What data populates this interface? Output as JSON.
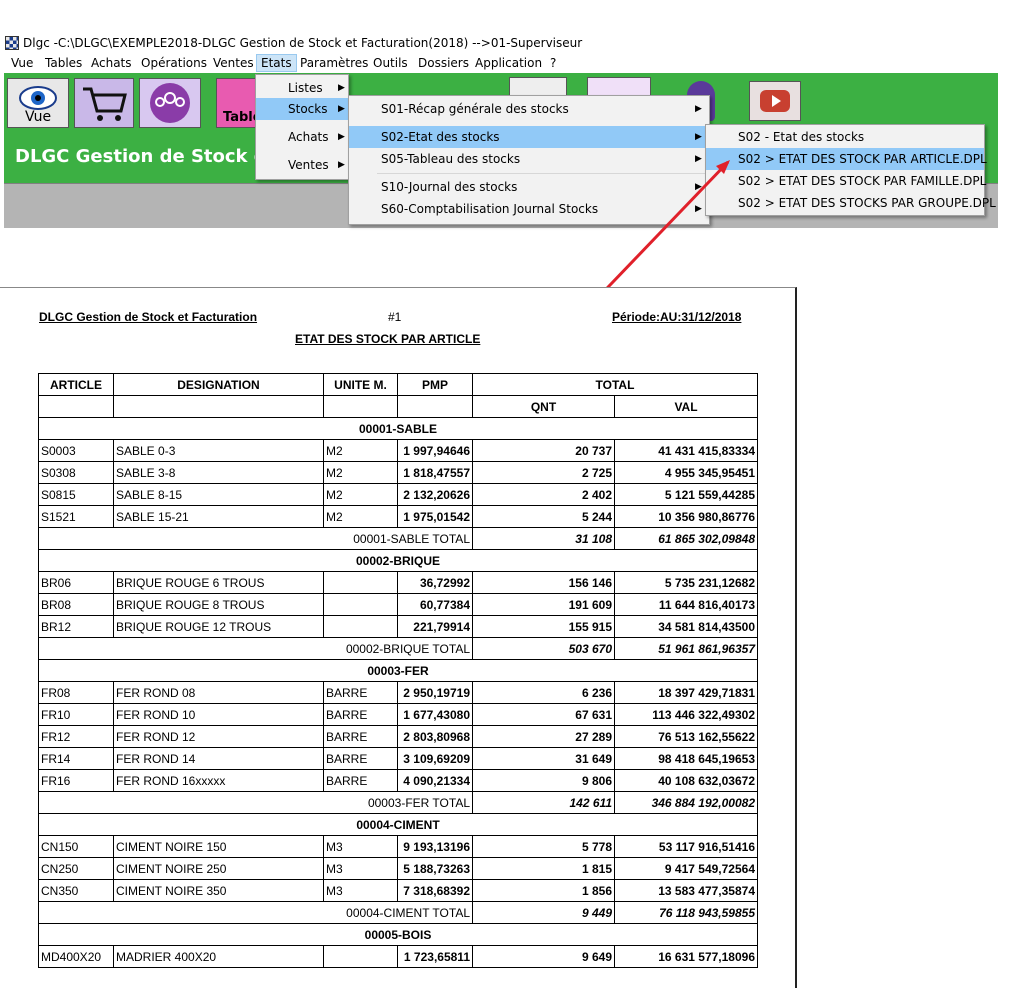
{
  "window": {
    "title": "Dlgc -C:\\DLGC\\EXEMPLE2018-DLGC Gestion de Stock et Facturation(2018) -->01-Superviseur"
  },
  "menubar": [
    "Vue",
    "Tables",
    "Achats",
    "Opérations",
    "Ventes",
    "Etats",
    "Paramètres",
    "Outils",
    "Dossiers",
    "Application",
    "?"
  ],
  "toolbar": {
    "vue_label": "Vue",
    "tables_label": "Table"
  },
  "app_title": "DLGC Gestion de Stock e",
  "menu_etats": [
    "Listes",
    "Stocks",
    "Achats",
    "Ventes"
  ],
  "menu_stocks": [
    "S01-Récap générale des stocks",
    "S02-Etat des stocks",
    "S05-Tableau des stocks",
    "S10-Journal des stocks",
    "S60-Comptabilisation Journal Stocks"
  ],
  "menu_s02": [
    "S02 - Etat des stocks",
    "S02 > ETAT DES STOCK PAR ARTICLE.DPL",
    "S02 > ETAT DES STOCK PAR FAMILLE.DPL",
    "S02 > ETAT DES STOCKS PAR GROUPE.DPL"
  ],
  "colors": {
    "toolbar_green": "#3cb043",
    "highlight": "#91c9f7",
    "arrow_red": "#e0202a"
  },
  "report": {
    "company": "DLGC Gestion de Stock et Facturation",
    "page": "#1",
    "period": "Période:AU:31/12/2018",
    "title": "ETAT DES STOCK PAR ARTICLE",
    "headers": {
      "article": "ARTICLE",
      "designation": "DESIGNATION",
      "unite": "UNITE M.",
      "pmp": "PMP",
      "total": "TOTAL",
      "qnt": "QNT",
      "val": "VAL"
    },
    "groups": [
      {
        "name": "00001-SABLE",
        "rows": [
          [
            "S0003",
            "SABLE 0-3",
            "M2",
            "1 997,94646",
            "20 737",
            "41 431 415,83334"
          ],
          [
            "S0308",
            "SABLE 3-8",
            "M2",
            "1 818,47557",
            "2 725",
            "4 955 345,95451"
          ],
          [
            "S0815",
            "SABLE 8-15",
            "M2",
            "2 132,20626",
            "2 402",
            "5 121 559,44285"
          ],
          [
            "S1521",
            "SABLE 15-21",
            "M2",
            "1 975,01542",
            "5 244",
            "10 356 980,86776"
          ]
        ],
        "total_label": "00001-SABLE  TOTAL",
        "total_qnt": "31 108",
        "total_val": "61 865 302,09848"
      },
      {
        "name": "00002-BRIQUE",
        "rows": [
          [
            "BR06",
            "BRIQUE ROUGE 6 TROUS",
            "",
            "36,72992",
            "156 146",
            "5 735 231,12682"
          ],
          [
            "BR08",
            "BRIQUE ROUGE 8 TROUS",
            "",
            "60,77384",
            "191 609",
            "11 644 816,40173"
          ],
          [
            "BR12",
            "BRIQUE ROUGE 12 TROUS",
            "",
            "221,79914",
            "155 915",
            "34 581 814,43500"
          ]
        ],
        "total_label": "00002-BRIQUE  TOTAL",
        "total_qnt": "503 670",
        "total_val": "51 961 861,96357"
      },
      {
        "name": "00003-FER",
        "rows": [
          [
            "FR08",
            "FER ROND 08",
            "BARRE",
            "2 950,19719",
            "6 236",
            "18 397 429,71831"
          ],
          [
            "FR10",
            "FER ROND 10",
            "BARRE",
            "1 677,43080",
            "67 631",
            "113 446 322,49302"
          ],
          [
            "FR12",
            "FER ROND 12",
            "BARRE",
            "2 803,80968",
            "27 289",
            "76 513 162,55622"
          ],
          [
            "FR14",
            "FER ROND 14",
            "BARRE",
            "3 109,69209",
            "31 649",
            "98 418 645,19653"
          ],
          [
            "FR16",
            "FER ROND 16xxxxx",
            "BARRE",
            "4 090,21334",
            "9 806",
            "40 108 632,03672"
          ]
        ],
        "total_label": "00003-FER  TOTAL",
        "total_qnt": "142 611",
        "total_val": "346 884 192,00082"
      },
      {
        "name": "00004-CIMENT",
        "rows": [
          [
            "CN150",
            "CIMENT NOIRE 150",
            "M3",
            "9 193,13196",
            "5 778",
            "53 117 916,51416"
          ],
          [
            "CN250",
            "CIMENT NOIRE 250",
            "M3",
            "5 188,73263",
            "1 815",
            "9 417 549,72564"
          ],
          [
            "CN350",
            "CIMENT NOIRE 350",
            "M3",
            "7 318,68392",
            "1 856",
            "13 583 477,35874"
          ]
        ],
        "total_label": "00004-CIMENT  TOTAL",
        "total_qnt": "9 449",
        "total_val": "76 118 943,59855"
      },
      {
        "name": "00005-BOIS",
        "rows": [
          [
            "MD400X20",
            "MADRIER 400X20",
            "",
            "1 723,65811",
            "9 649",
            "16 631 577,18096"
          ]
        ]
      }
    ]
  }
}
